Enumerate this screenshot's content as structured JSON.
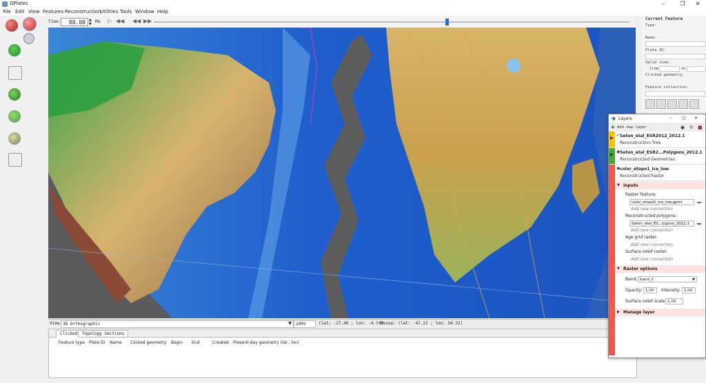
{
  "window": {
    "title": "GPlates"
  },
  "menu": [
    "File",
    "Edit",
    "View",
    "Features",
    "Reconstruction",
    "Utilities",
    "Tools",
    "Window",
    "Help"
  ],
  "timebar": {
    "label": "Time:",
    "value": "80.00",
    "unit": "Ma"
  },
  "viewbar": {
    "view_label": "View:",
    "projection": "3D Orthographic",
    "zoom": "200%",
    "lat_lon": "(lat: -27.40 ; lon: -4.74)",
    "mouse": "Mouse: (lat: -47.22 ; lon: 54.32)"
  },
  "bottom": {
    "tabs": [
      "Clicked",
      "Topology Sections"
    ],
    "columns": [
      "Feature type",
      "Plate ID",
      "Name",
      "Clicked geometry",
      "Begin",
      "End",
      "Created",
      "Present-day geometry (lat ; lon)"
    ]
  },
  "current_feature": {
    "title": "Current Feature",
    "fields": [
      "Type:",
      "Name:",
      "Plate ID:",
      "Valid time:",
      "from",
      "to",
      "Clicked geometry:",
      "Feature collection:"
    ]
  },
  "layers": {
    "title": "Layers",
    "add_label": "Add new layer",
    "rows": [
      {
        "name": "Seton_etal_ESR2012_2012.1",
        "type": "Reconstruction Tree",
        "color": "#f6c300"
      },
      {
        "name": "Seton_etal_ESR2...Polygons_2012.1",
        "type": "Reconstructed Geometries",
        "color": "#4aa832"
      },
      {
        "name": "color_etopo1_ice_low",
        "type": "Reconstructed Raster",
        "color": "#f0584a"
      }
    ],
    "inputs_header": "Inputs",
    "raster_feature_label": "Raster feature:",
    "raster_feature_value": "color_etopo1_ice_low.gpml",
    "add_connection": "Add new connection",
    "recon_polygons_label": "Reconstructed polygons:",
    "recon_polygons_value": "Seton_etal_ES...lygons_2012.1",
    "age_grid_label": "Age grid raster:",
    "surface_relief_label": "Surface relief raster:",
    "raster_options_header": "Raster options",
    "band_label": "Band:",
    "band_value": "band_1",
    "opacity_label": "Opacity:",
    "opacity_value": "1.00",
    "intensity_label": "Intensity:",
    "intensity_value": "1.00",
    "relief_scale_label": "Surface relief scale:",
    "relief_scale_value": "1.00",
    "manage_header": "Manage layer"
  }
}
